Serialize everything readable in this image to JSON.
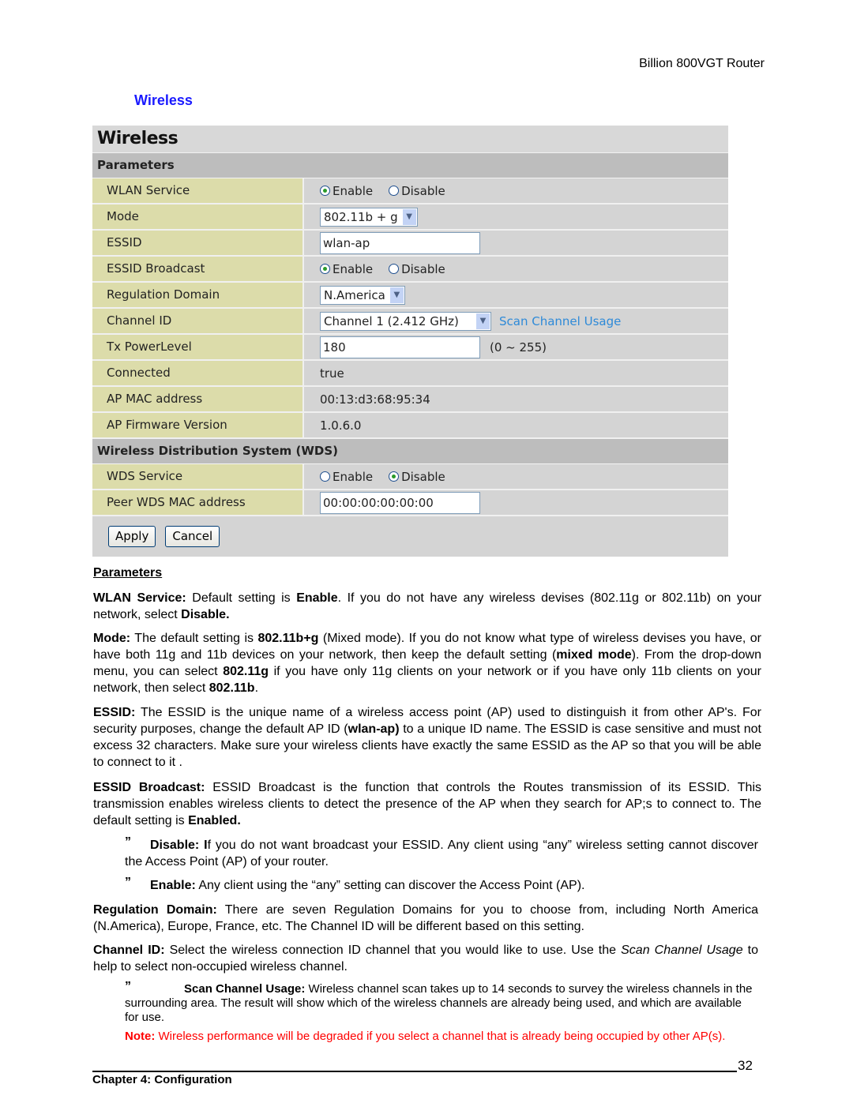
{
  "header": {
    "product": "Billion 800VGT Router"
  },
  "section_title": "Wireless",
  "panel": {
    "title": "Wireless",
    "groups": {
      "parameters": "Parameters",
      "wds": "Wireless Distribution System (WDS)"
    },
    "rows": {
      "wlan_service": {
        "label": "WLAN Service",
        "options": [
          "Enable",
          "Disable"
        ],
        "selected": "Enable"
      },
      "mode": {
        "label": "Mode",
        "value": "802.11b + g"
      },
      "essid": {
        "label": "ESSID",
        "value": "wlan-ap"
      },
      "essid_broadcast": {
        "label": "ESSID Broadcast",
        "options": [
          "Enable",
          "Disable"
        ],
        "selected": "Enable"
      },
      "regulation_domain": {
        "label": "Regulation Domain",
        "value": "N.America"
      },
      "channel_id": {
        "label": "Channel ID",
        "value": "Channel 1 (2.412 GHz)",
        "link": "Scan Channel Usage"
      },
      "tx_power": {
        "label": "Tx PowerLevel",
        "value": "180",
        "hint": "(0 ~ 255)"
      },
      "connected": {
        "label": "Connected",
        "value": "true"
      },
      "ap_mac": {
        "label": "AP MAC address",
        "value": "00:13:d3:68:95:34"
      },
      "ap_firmware": {
        "label": "AP Firmware Version",
        "value": "1.0.6.0"
      },
      "wds_service": {
        "label": "WDS Service",
        "options": [
          "Enable",
          "Disable"
        ],
        "selected": "Disable"
      },
      "peer_wds_mac": {
        "label": "Peer WDS MAC address",
        "value": "00:00:00:00:00:00"
      }
    },
    "buttons": {
      "apply": "Apply",
      "cancel": "Cancel"
    }
  },
  "doc": {
    "params_heading": "Parameters",
    "wlan": {
      "term": "WLAN Service:",
      "t1": " Default setting is ",
      "b1": "Enable",
      "t2": ". If you do not have any wireless devises (802.11g or 802.11b) on your network, select ",
      "b2": "Disable."
    },
    "mode": {
      "term": "Mode:",
      "t1": " The default setting is ",
      "b1": "802.11b+g",
      "t2": " (Mixed mode). If you do not know what type of wireless devises you have, or have both 11g and 11b devices on your network, then keep the default setting (",
      "b2": "mixed mode",
      "t3": ").   From the drop-down menu, you can select ",
      "b3": "802.11g",
      "t4": " if you have only 11g clients on your network or if you have only 11b clients on your network, then select ",
      "b4": "802.11b",
      "t5": "."
    },
    "essid": {
      "term": "ESSID:",
      "t1": " The ESSID is the unique name of a wireless access point (AP) used to distinguish it from other AP's.  For security purposes, change the default AP ID (",
      "b1": "wlan-ap)",
      "t2": " to a unique ID name. The ESSID is case sensitive and must not excess 32 characters. Make sure your wireless clients have exactly the same   ESSID as the AP so that you will be able to connect to it ."
    },
    "broadcast": {
      "term": "ESSID Broadcast:",
      "t1": "   ESSID Broadcast is the function that controls the Routes transmission of its ESSID. This transmission enables wireless clients to detect the presence of the AP when they search for AP;s to connect to. The default setting is ",
      "b1": "Enabled."
    },
    "bullet_disable": {
      "term": "Disable: I",
      "t1": "f you do not want broadcast your ESSID.   Any client using “any” wireless setting cannot discover the Access Point (AP) of your router."
    },
    "bullet_enable": {
      "term": "Enable:",
      "t1": " Any client using the “any” setting can discover the Access Point (AP)."
    },
    "regulation": {
      "term": "Regulation Domain:",
      "t1": " There are seven Regulation Domains for you to choose from, including North America (N.America), Europe, France, etc. The Channel ID will be different based on this setting."
    },
    "channel": {
      "term": "Channel ID:",
      "t1": " Select the wireless connection ID channel that you would like to use.  Use the ",
      "i1": "Scan Channel Usage",
      "t2": " to help to select non-occupied wireless channel."
    },
    "scan": {
      "term": "Scan Channel Usage:",
      "t1": " Wireless channel scan takes up to 14 seconds to survey the wireless channels in the surrounding area. The result will show which of the wireless channels are already being used, and which are available for use."
    },
    "note": {
      "term": "Note:",
      "t1": " Wireless performance will be degraded if you select a channel that is already being occupied by other AP(s)."
    },
    "bullet_glyph": "”"
  },
  "footer": {
    "page": "32",
    "chapter": "Chapter 4: Configuration"
  }
}
